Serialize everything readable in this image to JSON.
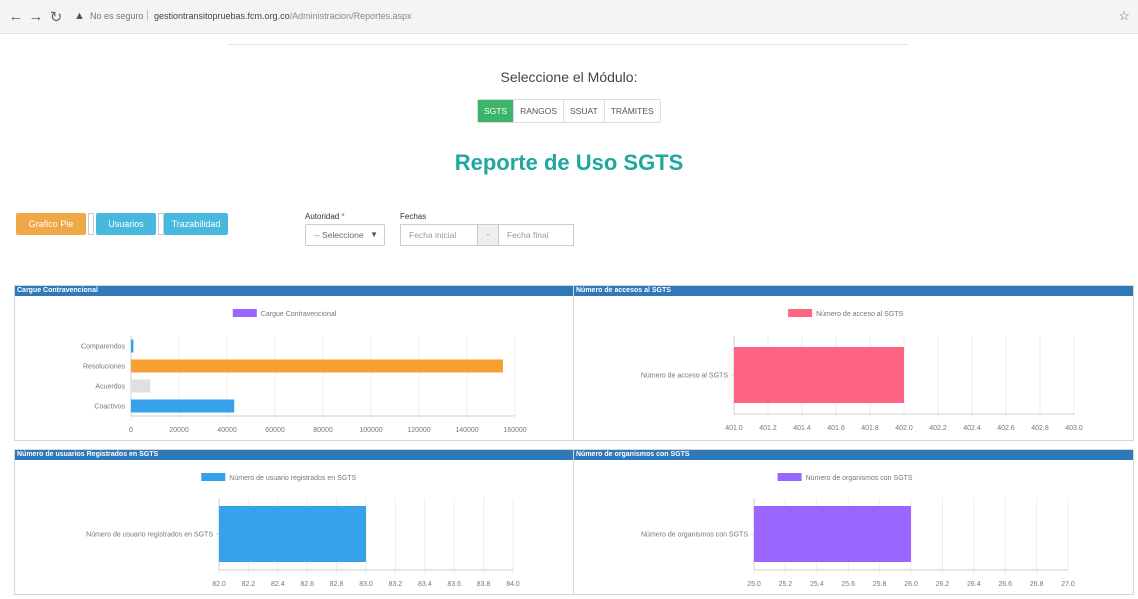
{
  "browser": {
    "back_icon": "arrow-left-icon",
    "forward_icon": "arrow-right-icon",
    "reload_icon": "reload-icon",
    "security_text": "No es seguro",
    "url_host": "gestiontransitopruebas.fcm.org.co",
    "url_path": "/Administracion/Reportes.aspx",
    "bookmark_icon": "star-icon"
  },
  "module_selector": {
    "label": "Seleccione el Módulo:",
    "buttons": [
      "SGTS",
      "RANGOS",
      "SSUAT",
      "TRÁMITES"
    ],
    "active": "SGTS",
    "active_color": "#3cb46a"
  },
  "page_title": "Reporte de Uso SGTS",
  "report_tabs": {
    "grafico": "Grafico Pie",
    "usuarios": "Usuarios",
    "trazabilidad": "Trazabilidad"
  },
  "filters": {
    "autoridad_label": "Autoridad",
    "autoridad_required_mark": "*",
    "autoridad_value": "-- Seleccione",
    "fechas_label": "Fechas",
    "fecha_inicial_placeholder": "Fecha inicial",
    "fecha_sep": "-",
    "fecha_final_placeholder": "Fecha final"
  },
  "colors": {
    "title": "#1fa7a0",
    "panel_header": "#2f79b9",
    "tab_orange": "#f0a745",
    "tab_blue": "#49b8df"
  },
  "chart_data": [
    {
      "type": "bar",
      "orientation": "horizontal",
      "title": "Cargue Contravencional",
      "legend": "Cargue Contravencional",
      "legend_color": "#9966ff",
      "categories": [
        "Comparendos",
        "Resoluciones",
        "Acuerdos",
        "Coactivos"
      ],
      "values": [
        1000,
        155000,
        8000,
        43000
      ],
      "bar_colors": [
        "#36a2eb",
        "#f5a031",
        "#e0e0e0",
        "#36a2eb"
      ],
      "xlim": [
        0,
        160000
      ],
      "xticks": [
        "0",
        "20000",
        "40000",
        "60000",
        "80000",
        "100000",
        "120000",
        "140000",
        "160000"
      ]
    },
    {
      "type": "bar",
      "orientation": "horizontal",
      "title": "Número de accesos al SGTS",
      "legend": "Número de acceso al SGTS",
      "legend_color": "#ff6384",
      "categories": [
        "Número de acceso al SGTS"
      ],
      "values": [
        402.0
      ],
      "xlim": [
        401.0,
        403.0
      ],
      "xticks": [
        "401.0",
        "401.2",
        "401.4",
        "401.6",
        "401.8",
        "402.0",
        "402.2",
        "402.4",
        "402.6",
        "402.8",
        "403.0"
      ]
    },
    {
      "type": "bar",
      "orientation": "horizontal",
      "title": "Número de usuarios Registrados en SGTS",
      "legend": "Número de usuario registrados en SGTS",
      "legend_color": "#36a2eb",
      "categories": [
        "Número de usuario registrados en SGTS"
      ],
      "values": [
        83.0
      ],
      "xlim": [
        82.0,
        84.0
      ],
      "xticks": [
        "82.0",
        "82.2",
        "82.4",
        "82.6",
        "82.8",
        "83.0",
        "83.2",
        "83.4",
        "83.6",
        "83.8",
        "84.0"
      ]
    },
    {
      "type": "bar",
      "orientation": "horizontal",
      "title": "Número de organismos con SGTS",
      "legend": "Número de organismos con SGTS",
      "legend_color": "#9966ff",
      "categories": [
        "Número de organismos con SGTS"
      ],
      "values": [
        26.0
      ],
      "xlim": [
        25.0,
        27.0
      ],
      "xticks": [
        "25.0",
        "25.2",
        "25.4",
        "25.6",
        "25.8",
        "26.0",
        "26.2",
        "26.4",
        "26.6",
        "26.8",
        "27.0"
      ]
    }
  ]
}
